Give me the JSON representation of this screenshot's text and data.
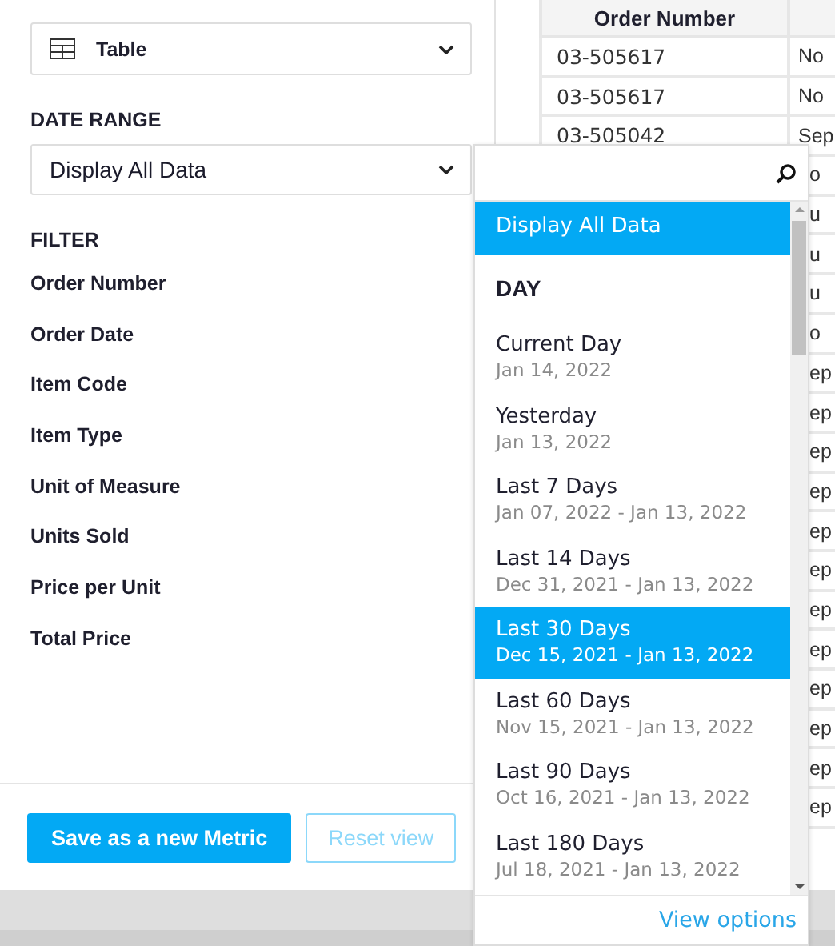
{
  "chart_type": {
    "value": "Table"
  },
  "date_range": {
    "label": "DATE RANGE",
    "value": "Display All Data"
  },
  "filter": {
    "label": "FILTER",
    "fields": [
      "Order Number",
      "Order Date",
      "Item Code",
      "Item Type",
      "Unit of Measure",
      "Units Sold",
      "Price per Unit",
      "Total Price"
    ]
  },
  "buttons": [
    {
      "label": "Save as a new Metric",
      "kind": "primary",
      "disabled": false
    },
    {
      "label": "Reset view",
      "kind": "secondary",
      "disabled": true
    }
  ],
  "table": {
    "columns": [
      "Order Number"
    ],
    "rows": [
      {
        "order_number": "03-505617",
        "column_2": "No"
      },
      {
        "order_number": "03-505617",
        "column_2": "No"
      },
      {
        "order_number": "03-505042",
        "column_2": "Sep"
      },
      {
        "column_2": "o"
      },
      {
        "column_2": "u"
      },
      {
        "column_2": "u"
      },
      {
        "column_2": "u"
      },
      {
        "column_2": "o"
      },
      {
        "column_2": "ep"
      },
      {
        "column_2": "ep"
      },
      {
        "column_2": "ep"
      },
      {
        "column_2": "ep"
      },
      {
        "column_2": "ep"
      },
      {
        "column_2": "ep"
      },
      {
        "column_2": "ep"
      },
      {
        "column_2": "ep"
      },
      {
        "column_2": "ep"
      },
      {
        "column_2": "ep"
      },
      {
        "column_2": "ep"
      },
      {
        "column_2": "ep"
      }
    ]
  },
  "dropdown": {
    "options": [
      {
        "kind": "option",
        "label": "Display All Data",
        "selected": true
      },
      {
        "kind": "heading",
        "label": "DAY"
      },
      {
        "kind": "option",
        "label": "Current Day",
        "range": "Jan 14, 2022",
        "selected": false
      },
      {
        "kind": "option",
        "label": "Yesterday",
        "range": "Jan 13, 2022",
        "selected": false
      },
      {
        "kind": "option",
        "label": "Last 7 Days",
        "range": "Jan 07, 2022 - Jan 13, 2022",
        "selected": false
      },
      {
        "kind": "option",
        "label": "Last 14 Days",
        "range": "Dec 31, 2021 - Jan 13, 2022",
        "selected": false
      },
      {
        "kind": "option",
        "label": "Last 30 Days",
        "range": "Dec 15, 2021 - Jan 13, 2022",
        "selected": true
      },
      {
        "kind": "option",
        "label": "Last 60 Days",
        "range": "Nov 15, 2021 - Jan 13, 2022",
        "selected": false
      },
      {
        "kind": "option",
        "label": "Last 90 Days",
        "range": "Oct 16, 2021 - Jan 13, 2022",
        "selected": false
      },
      {
        "kind": "option",
        "label": "Last 180 Days",
        "range": "Jul 18, 2021 - Jan 13, 2022",
        "selected": false
      }
    ],
    "footer_link": "View options"
  }
}
